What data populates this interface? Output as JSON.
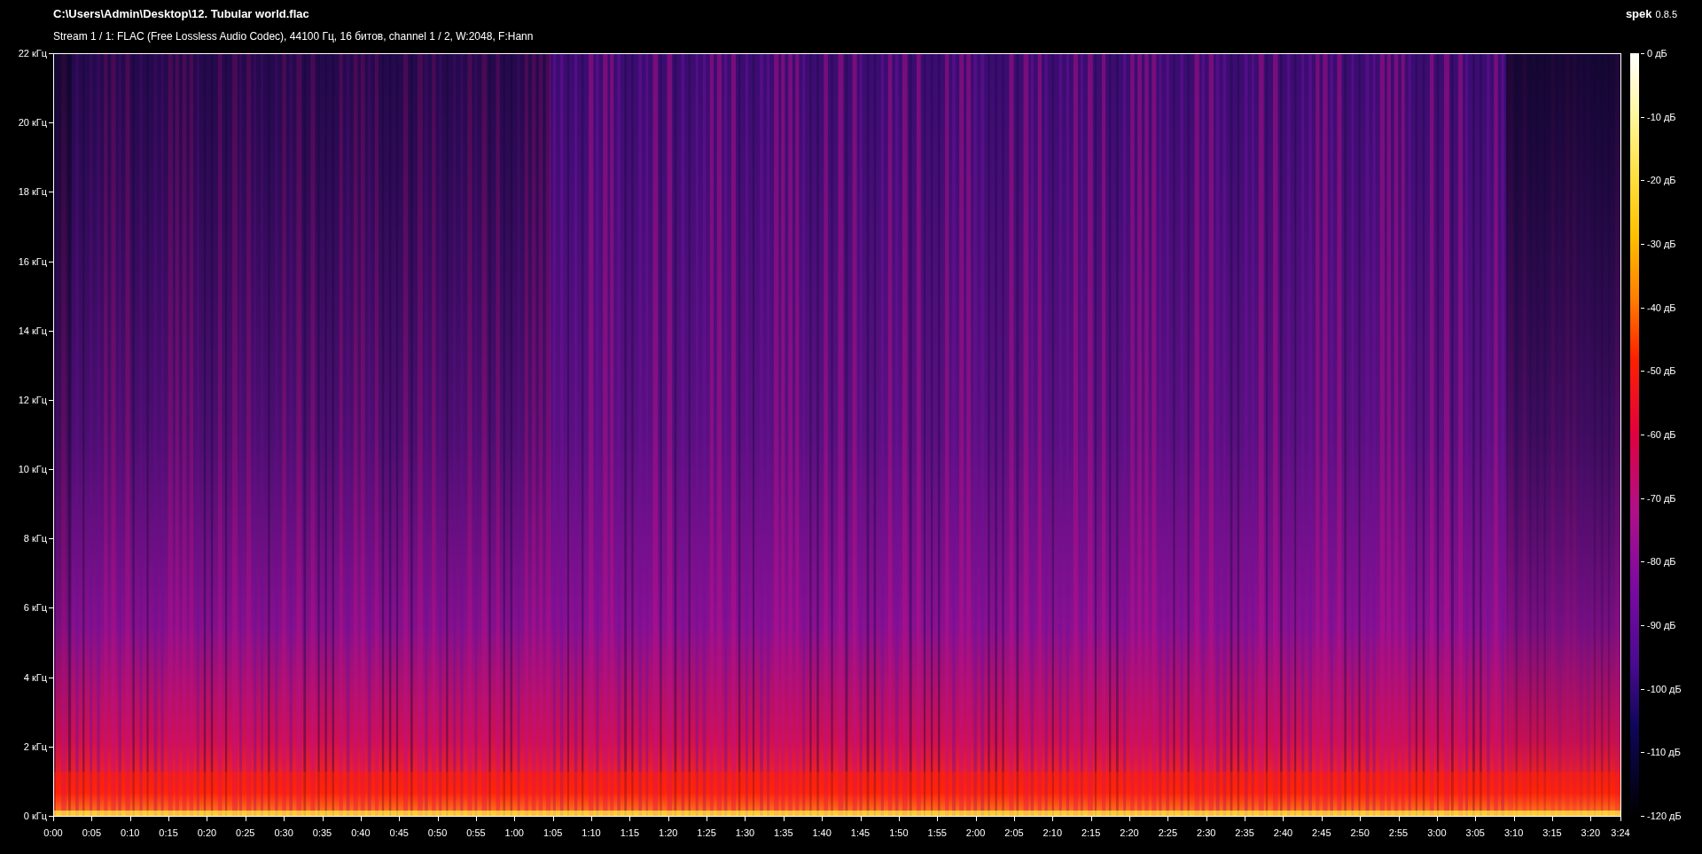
{
  "header": {
    "file_path": "C:\\Users\\Admin\\Desktop\\12. Tubular world.flac",
    "stream_info": "Stream 1 / 1: FLAC (Free Lossless Audio Codec), 44100 Гц, 16 битов, channel 1 / 2, W:2048, F:Hann",
    "app_name": "spek",
    "app_version": "0.8.5"
  },
  "spectrogram": {
    "kind": "picture",
    "frequency_axis": [
      "22 кГц",
      "20 кГц",
      "18 кГц",
      "16 кГц",
      "14 кГц",
      "12 кГц",
      "10 кГц",
      "8 кГц",
      "6 кГц",
      "4 кГц",
      "2 кГц",
      "0 кГц"
    ],
    "time_axis": [
      "0:00",
      "0:05",
      "0:10",
      "0:15",
      "0:20",
      "0:25",
      "0:30",
      "0:35",
      "0:40",
      "0:45",
      "0:50",
      "0:55",
      "1:00",
      "1:05",
      "1:10",
      "1:15",
      "1:20",
      "1:25",
      "1:30",
      "1:35",
      "1:40",
      "1:45",
      "1:50",
      "1:55",
      "2:00",
      "2:05",
      "2:10",
      "2:15",
      "2:20",
      "2:25",
      "2:30",
      "2:35",
      "2:40",
      "2:45",
      "2:50",
      "2:55",
      "3:00",
      "3:05",
      "3:10",
      "3:15",
      "3:20",
      "3:24"
    ]
  },
  "level_scale": [
    "0 дБ",
    "-10 дБ",
    "-20 дБ",
    "-30 дБ",
    "-40 дБ",
    "-50 дБ",
    "-60 дБ",
    "-70 дБ",
    "-80 дБ",
    "-90 дБ",
    "-100 дБ",
    "-110 дБ",
    "-120 дБ"
  ]
}
